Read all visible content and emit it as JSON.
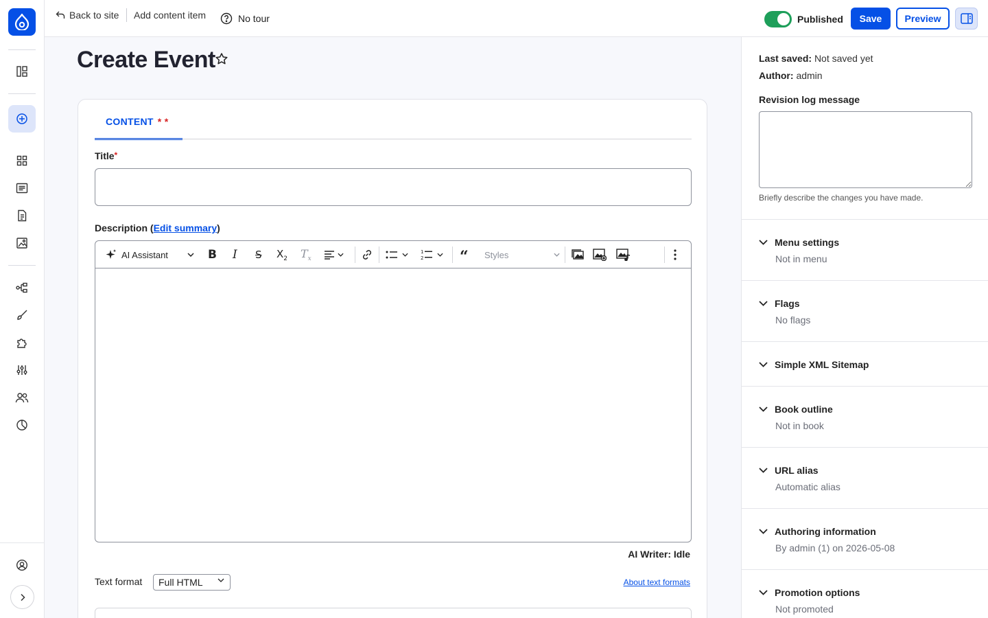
{
  "topbar": {
    "back_label": "Back to site",
    "add_label": "Add content item",
    "tour_label": "No tour",
    "published_label": "Published",
    "published": true,
    "save_label": "Save",
    "preview_label": "Preview"
  },
  "rail": {
    "icons": [
      "drupal-logo-icon",
      "content-overview-icon",
      "create-icon",
      "dashboard-icon",
      "content-list-icon",
      "files-icon",
      "media-icon",
      "structure-icon",
      "appearance-icon",
      "extend-icon",
      "configuration-icon",
      "people-icon",
      "reports-icon",
      "user-icon",
      "expand-icon"
    ]
  },
  "page": {
    "title": "Create Event"
  },
  "form": {
    "tab_label": "CONTENT",
    "tab_markers": "* *",
    "title_label": "Title",
    "title_value": "",
    "description_label_prefix": "Description (",
    "edit_summary_link": "Edit summary",
    "description_label_suffix": ")",
    "ai_assistant_label": "AI Assistant",
    "styles_label": "Styles",
    "ai_writer_status": "AI Writer: Idle",
    "text_format_label": "Text format",
    "text_format_value": "Full HTML",
    "about_text_formats": "About text formats"
  },
  "sidebar": {
    "last_saved_label": "Last saved:",
    "last_saved_value": "Not saved yet",
    "author_label": "Author:",
    "author_value": "admin",
    "revision_label": "Revision log message",
    "revision_help": "Briefly describe the changes you have made.",
    "sections": [
      {
        "title": "Menu settings",
        "summary": "Not in menu"
      },
      {
        "title": "Flags",
        "summary": "No flags"
      },
      {
        "title": "Simple XML Sitemap",
        "summary": ""
      },
      {
        "title": "Book outline",
        "summary": "Not in book"
      },
      {
        "title": "URL alias",
        "summary": "Automatic alias"
      },
      {
        "title": "Authoring information",
        "summary": "By admin (1) on 2026-05-08"
      },
      {
        "title": "Promotion options",
        "summary": "Not promoted"
      }
    ]
  },
  "colors": {
    "accent": "#0550e6",
    "toggle_on": "#1e9f5a",
    "required": "#d72222"
  }
}
